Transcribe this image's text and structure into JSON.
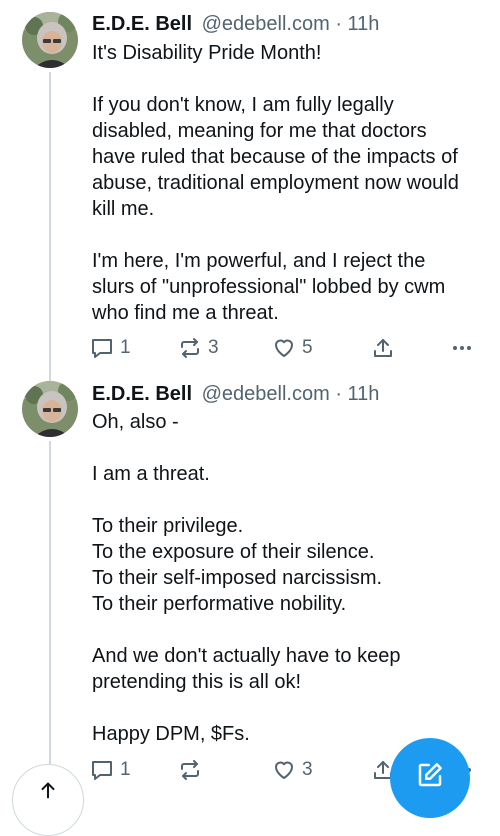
{
  "colors": {
    "text": "#0f1419",
    "muted": "#536471",
    "accent": "#1d9bf0",
    "thread_line": "#cfd9de"
  },
  "posts": [
    {
      "author": "E.D.E. Bell",
      "handle": "@edebell.com",
      "separator": "·",
      "time": "11h",
      "paragraphs": [
        [
          "It's Disability Pride Month!"
        ],
        [
          "If you don't know, I am fully legally",
          "disabled, meaning for me that doctors",
          "have ruled that because of the impacts of",
          "abuse, traditional employment now would",
          "kill me."
        ],
        [
          "I'm here, I'm powerful, and I reject the",
          "slurs of \"unprofessional\" lobbed by cwm",
          "who find me a threat."
        ]
      ],
      "actions": {
        "reply_icon": "reply-icon",
        "reply_count": "1",
        "repost_icon": "repost-icon",
        "repost_count": "3",
        "like_icon": "heart-icon",
        "like_count": "5",
        "share_icon": "share-icon",
        "more_icon": "more-icon"
      }
    },
    {
      "author": "E.D.E. Bell",
      "handle": "@edebell.com",
      "separator": "·",
      "time": "11h",
      "paragraphs": [
        [
          "Oh, also -"
        ],
        [
          "I am a threat."
        ],
        [
          "To their privilege.",
          "To the exposure of their silence.",
          "To their self-imposed narcissism.",
          "To their performative nobility."
        ],
        [
          "And we don't actually have to keep",
          "pretending this is all ok!"
        ],
        [
          "Happy DPM, $Fs."
        ]
      ],
      "actions": {
        "reply_icon": "reply-icon",
        "reply_count": "1",
        "repost_icon": "repost-icon",
        "like_icon": "heart-icon",
        "like_count": "3",
        "share_icon": "share-icon",
        "more_icon": "more-icon"
      }
    }
  ],
  "floating": {
    "scroll_top_icon": "arrow-up-icon",
    "compose_icon": "compose-icon"
  }
}
